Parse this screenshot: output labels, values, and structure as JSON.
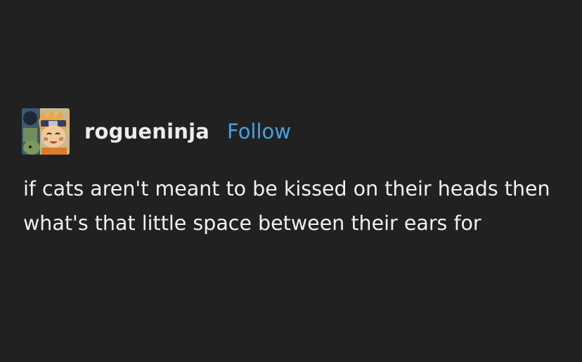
{
  "post": {
    "username": "rogueninja",
    "follow_label": "Follow",
    "avatar_icon": "anime-avatar-icon",
    "body_text": "if cats aren't meant to be kissed on their heads then what's that little space between their ears for"
  },
  "colors": {
    "background": "#212121",
    "text": "#f1f1f1",
    "follow_link": "#4a9fde"
  }
}
